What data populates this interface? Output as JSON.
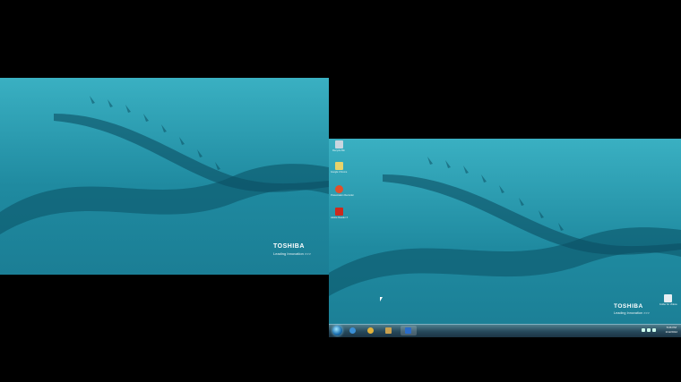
{
  "left_screen": {
    "brand": "TOSHIBA",
    "tagline": "Leading Innovation >>>"
  },
  "right_screen": {
    "brand": "TOSHIBA",
    "tagline": "Leading Innovation >>>",
    "desktop_icons": [
      {
        "label": "Recycle Bin",
        "icon": "recycle-bin-icon",
        "color": "#c9d6e0"
      },
      {
        "label": "Google Chrome",
        "icon": "folder-icon",
        "color": "#e8d36a"
      },
      {
        "label": "Presentation Recorder",
        "icon": "recorder-icon",
        "color": "#e0502a"
      },
      {
        "label": "Adobe Reader X",
        "icon": "pdf-icon",
        "color": "#cc2a1e"
      }
    ],
    "right_icon": {
      "label": "Folder for Videos",
      "icon": "document-icon"
    },
    "taskbar": {
      "apps": [
        {
          "name": "ie-icon",
          "color": "#3a8fd6"
        },
        {
          "name": "chrome-icon",
          "color": "#e2b23a"
        },
        {
          "name": "media-icon",
          "color": "#c8a050"
        },
        {
          "name": "word-icon",
          "color": "#2a6cc8"
        }
      ],
      "clock_time": "5:06 PM",
      "clock_date": "1/12/2012"
    }
  },
  "colors": {
    "wallpaper_dark": "#0a4d5e",
    "wallpaper_light": "#2fa4b8"
  }
}
